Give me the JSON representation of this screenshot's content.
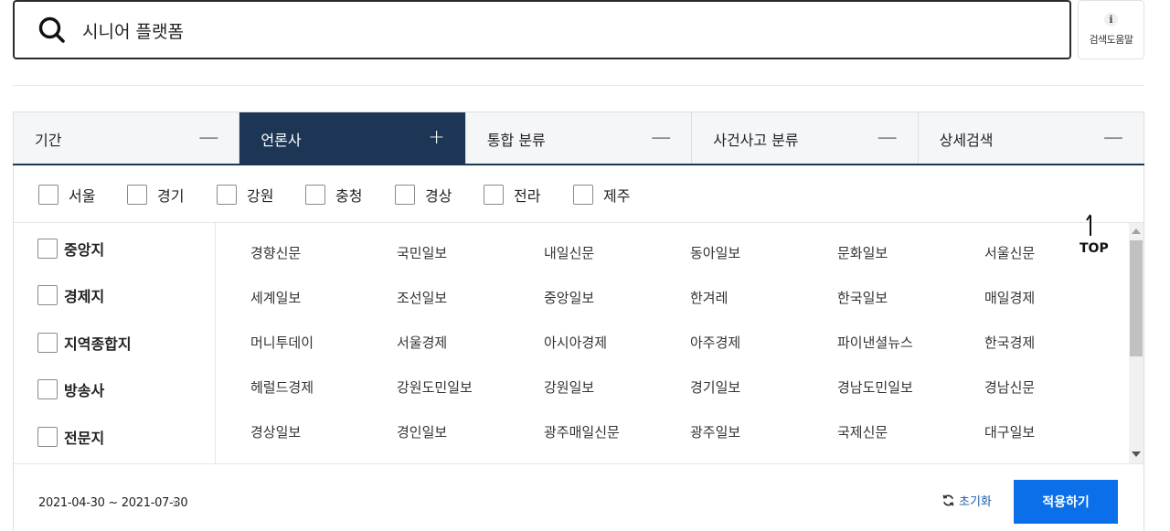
{
  "search": {
    "query": "시니어 플랫폼",
    "help_label": "검색도움말",
    "help_icon": "info-icon"
  },
  "tabs": [
    {
      "label": "기간",
      "toggle": "—",
      "active": false
    },
    {
      "label": "언론사",
      "toggle": "+",
      "active": true
    },
    {
      "label": "통합 분류",
      "toggle": "—",
      "active": false
    },
    {
      "label": "사건사고 분류",
      "toggle": "—",
      "active": false
    },
    {
      "label": "상세검색",
      "toggle": "—",
      "active": false
    }
  ],
  "regions": [
    "서울",
    "경기",
    "강원",
    "충청",
    "경상",
    "전라",
    "제주"
  ],
  "press_types": [
    "중앙지",
    "경제지",
    "지역종합지",
    "방송사",
    "전문지"
  ],
  "press_list": [
    [
      "경향신문",
      "국민일보",
      "내일신문",
      "동아일보",
      "문화일보",
      "서울신문"
    ],
    [
      "세계일보",
      "조선일보",
      "중앙일보",
      "한겨레",
      "한국일보",
      "매일경제"
    ],
    [
      "머니투데이",
      "서울경제",
      "아시아경제",
      "아주경제",
      "파이낸셜뉴스",
      "한국경제"
    ],
    [
      "헤럴드경제",
      "강원도민일보",
      "강원일보",
      "경기일보",
      "경남도민일보",
      "경남신문"
    ],
    [
      "경상일보",
      "경인일보",
      "광주매일신문",
      "광주일보",
      "국제신문",
      "대구일보"
    ]
  ],
  "top_button": {
    "label": "TOP"
  },
  "footer": {
    "date_range": "2021-04-30 ~ 2021-07-30",
    "clear_symbol": "×",
    "reset_label": "초기화",
    "apply_label": "적용하기"
  },
  "colors": {
    "active_tab": "#1d3655",
    "apply_button": "#0a6fe8",
    "reset_text": "#1e5aa8"
  }
}
